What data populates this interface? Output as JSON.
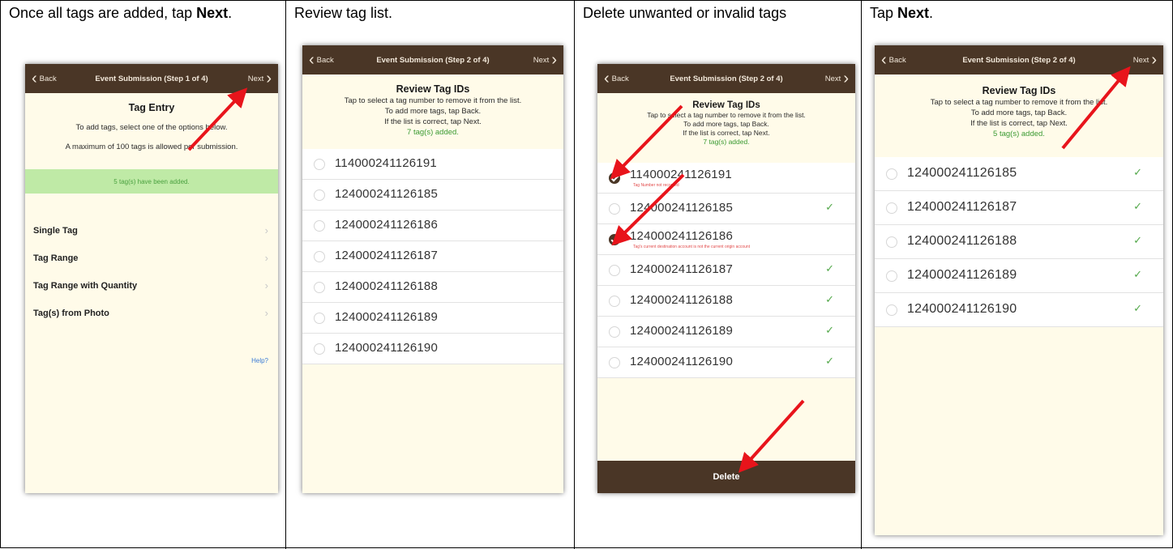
{
  "panels": [
    {
      "caption_pre": "Once all tags are added, tap ",
      "caption_bold": "Next",
      "caption_post": ".",
      "nav": {
        "back": "Back",
        "title": "Event Submission (Step 1 of 4)",
        "next": "Next"
      },
      "title": "Tag Entry",
      "line1": "To add tags, select one of the options below.",
      "line2": "A maximum of 100 tags is allowed per submission.",
      "banner": "5 tag(s) have been added.",
      "menu": [
        "Single Tag",
        "Tag Range",
        "Tag Range with Quantity",
        "Tag(s) from Photo"
      ],
      "help": "Help"
    },
    {
      "caption": "Review tag list.",
      "nav": {
        "back": "Back",
        "title": "Event Submission (Step 2 of 4)",
        "next": "Next"
      },
      "title": "Review Tag IDs",
      "lines": [
        "Tap to select a tag number to remove it from the list.",
        "To add more tags, tap Back.",
        "If the list is correct, tap Next."
      ],
      "count": "7 tag(s) added.",
      "tags": [
        "114000241126191",
        "124000241126185",
        "124000241126186",
        "124000241126187",
        "124000241126188",
        "124000241126189",
        "124000241126190"
      ]
    },
    {
      "caption": "Delete unwanted or invalid tags",
      "nav": {
        "back": "Back",
        "title": "Event Submission (Step 2 of 4)",
        "next": "Next"
      },
      "title": "Review Tag IDs",
      "lines": [
        "Tap to select a tag number to remove it from the list.",
        "To add more tags, tap Back.",
        "If the list is correct, tap Next."
      ],
      "count": "7 tag(s) added.",
      "tags": [
        {
          "id": "114000241126191",
          "selected": true,
          "valid": false,
          "error": "Tag Number not recorded"
        },
        {
          "id": "124000241126185",
          "selected": false,
          "valid": true,
          "error": ""
        },
        {
          "id": "124000241126186",
          "selected": true,
          "valid": false,
          "error": "Tag's current destination account is not the current origin account"
        },
        {
          "id": "124000241126187",
          "selected": false,
          "valid": true,
          "error": ""
        },
        {
          "id": "124000241126188",
          "selected": false,
          "valid": true,
          "error": ""
        },
        {
          "id": "124000241126189",
          "selected": false,
          "valid": true,
          "error": ""
        },
        {
          "id": "124000241126190",
          "selected": false,
          "valid": true,
          "error": ""
        }
      ],
      "delete_label": "Delete"
    },
    {
      "caption_pre": "Tap ",
      "caption_bold": "Next",
      "caption_post": ".",
      "nav": {
        "back": "Back",
        "title": "Event Submission (Step 2 of 4)",
        "next": "Next"
      },
      "title": "Review Tag IDs",
      "lines": [
        "Tap to select a tag number to remove it from the list.",
        "To add more tags, tap Back.",
        "If the list is correct, tap Next."
      ],
      "count": "5 tag(s) added.",
      "tags": [
        "124000241126185",
        "124000241126187",
        "124000241126188",
        "124000241126189",
        "124000241126190"
      ]
    }
  ],
  "colors": {
    "navbar": "#4a3626",
    "screen_bg": "#fffbe9",
    "arrow": "#e8141b",
    "ok_green": "#3a9a32",
    "banner": "#bfeaa6"
  }
}
